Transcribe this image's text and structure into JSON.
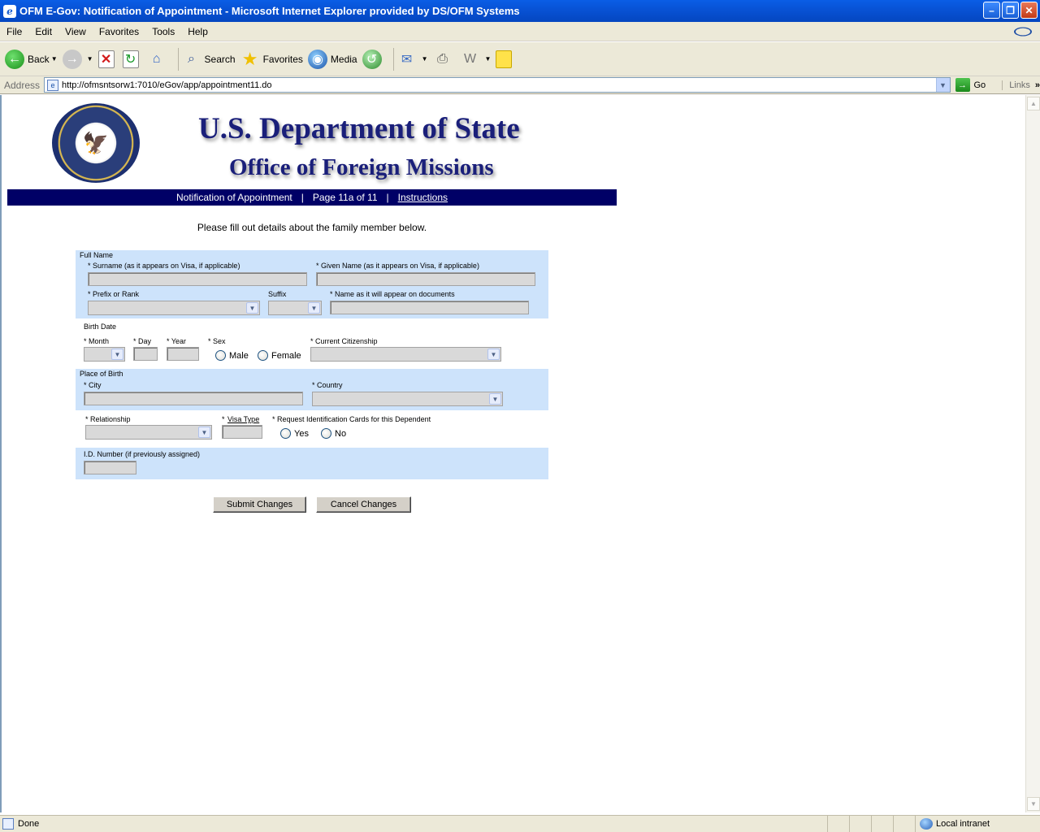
{
  "window": {
    "title": "OFM E-Gov: Notification of Appointment - Microsoft Internet Explorer provided by DS/OFM Systems",
    "minimize_glyph": "–",
    "maximize_glyph": "❐",
    "close_glyph": "✕"
  },
  "menu": [
    "File",
    "Edit",
    "View",
    "Favorites",
    "Tools",
    "Help"
  ],
  "toolbar": {
    "back": "Back",
    "search": "Search",
    "favorites": "Favorites",
    "media": "Media"
  },
  "address": {
    "label": "Address",
    "url": "http://ofmsntsorw1:7010/eGov/app/appointment11.do",
    "go": "Go",
    "links": "Links"
  },
  "header": {
    "title": "U.S. Department of State",
    "subtitle": "Office of Foreign Missions"
  },
  "nav": {
    "page_name": "Notification of Appointment",
    "separator": "|",
    "page_number": "Page 11a of 11",
    "instructions": "Instructions"
  },
  "intro": "Please fill out details about the family member below.",
  "form": {
    "full_name_heading": "Full Name",
    "surname_label": "* Surname (as it appears on Visa, if applicable)",
    "given_name_label": "* Given Name (as it appears on Visa, if applicable)",
    "prefix_label": "* Prefix or Rank",
    "suffix_label": "Suffix",
    "doc_name_label": "* Name as it will appear on documents",
    "birth_date_heading": "Birth Date",
    "month_label": "* Month",
    "day_label": "* Day",
    "year_label": "* Year",
    "sex_label": "* Sex",
    "sex_options": [
      "Male",
      "Female"
    ],
    "citizenship_label": "* Current Citizenship",
    "place_of_birth_heading": "Place of Birth",
    "city_label": "* City",
    "country_label": "* Country",
    "relationship_label": "* Relationship",
    "visa_type_star": "*",
    "visa_type_label": "Visa Type",
    "id_cards_label": "* Request Identification Cards for this Dependent",
    "id_cards_options": [
      "Yes",
      "No"
    ],
    "id_number_label": "I.D. Number (if previously assigned)"
  },
  "buttons": {
    "submit": "Submit Changes",
    "cancel": "Cancel Changes"
  },
  "status": {
    "text": "Done",
    "zone": "Local intranet"
  },
  "colors": {
    "title_bar": "#0853d6",
    "nav_strip": "#000066",
    "form_band": "#cde3fb",
    "heading_text": "#1a1f7a"
  }
}
